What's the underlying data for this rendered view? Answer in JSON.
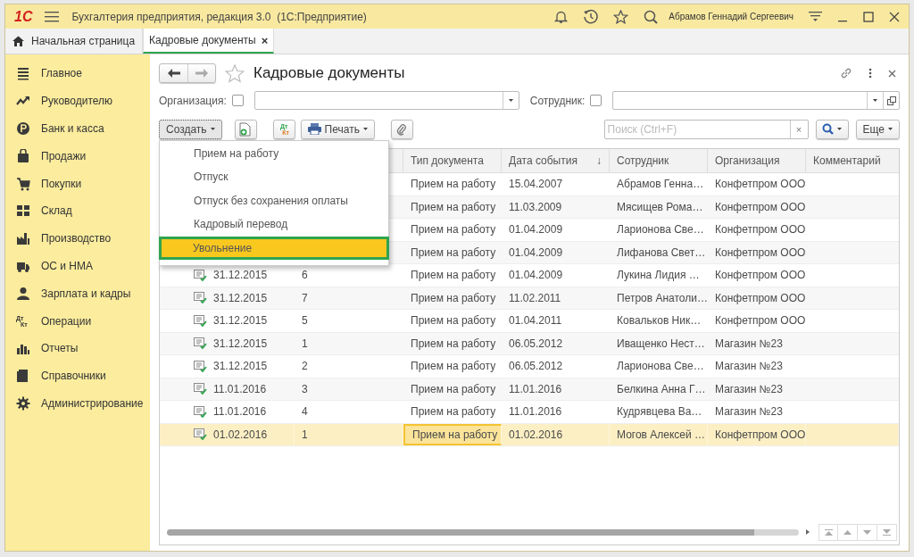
{
  "window": {
    "logo": "1С",
    "title": "Бухгалтерия предприятия, редакция 3.0  (1С:Предприятие)",
    "user": "Абрамов Геннадий Сергеевич"
  },
  "tabs": [
    {
      "label": "Начальная страница",
      "kind": "home",
      "selected": false
    },
    {
      "label": "Кадровые документы",
      "kind": "doc",
      "close": "×",
      "selected": true
    }
  ],
  "sidebar": {
    "items": [
      {
        "label": "Главное"
      },
      {
        "label": "Руководителю"
      },
      {
        "label": "Банк и касса"
      },
      {
        "label": "Продажи"
      },
      {
        "label": "Покупки"
      },
      {
        "label": "Склад"
      },
      {
        "label": "Производство"
      },
      {
        "label": "ОС и НМА"
      },
      {
        "label": "Зарплата и кадры"
      },
      {
        "label": "Операции",
        "glyph": [
          "Дт",
          "Кт"
        ]
      },
      {
        "label": "Отчеты"
      },
      {
        "label": "Справочники"
      },
      {
        "label": "Администрирование"
      }
    ]
  },
  "form": {
    "title": "Кадровые документы",
    "filters": [
      {
        "label": "Организация:",
        "checked": false,
        "open_button": false
      },
      {
        "label": "Сотрудник:",
        "checked": false,
        "open_button": true
      }
    ],
    "toolbar": {
      "create": "Создать",
      "dtkt": [
        "Дт",
        "Кт"
      ],
      "print": "Печать",
      "search_placeholder": "Поиск (Ctrl+F)",
      "search_clear": "×",
      "more": "Еще"
    },
    "create_menu": [
      {
        "label": "Прием на работу",
        "selected": false
      },
      {
        "label": "Отпуск",
        "selected": false
      },
      {
        "label": "Отпуск без сохранения оплаты",
        "selected": false
      },
      {
        "label": "Кадровый перевод",
        "selected": false
      },
      {
        "label": "Увольнение",
        "selected": true
      }
    ]
  },
  "table": {
    "columns": [
      {
        "label": "Тип документа"
      },
      {
        "label": "Дата события",
        "sort": "↓"
      },
      {
        "label": "Сотрудник"
      },
      {
        "label": "Организация"
      },
      {
        "label": "Комментарий"
      }
    ],
    "rows": [
      {
        "type": "Прием на работу",
        "event_date": "15.04.2007",
        "employee": "Абрамов Генна…",
        "organization": "Конфетпром ООО",
        "selected": false
      },
      {
        "type": "Прием на работу",
        "event_date": "11.03.2009",
        "employee": "Мясищев Рома…",
        "organization": "Конфетпром ООО",
        "selected": false
      },
      {
        "type": "Прием на работу",
        "event_date": "01.04.2009",
        "employee": "Ларионова Све…",
        "organization": "Конфетпром ООО",
        "selected": false
      },
      {
        "type": "Прием на работу",
        "event_date": "01.04.2009",
        "employee": "Лифанова Свет…",
        "organization": "Конфетпром ООО",
        "selected": false
      },
      {
        "date": "31.12.2015",
        "number": "6",
        "type": "Прием на работу",
        "event_date": "01.04.2009",
        "employee": "Лукина Лидия …",
        "organization": "Конфетпром ООО",
        "selected": false
      },
      {
        "date": "31.12.2015",
        "number": "7",
        "type": "Прием на работу",
        "event_date": "11.02.2011",
        "employee": "Петров Анатоли…",
        "organization": "Конфетпром ООО",
        "selected": false
      },
      {
        "date": "31.12.2015",
        "number": "5",
        "type": "Прием на работу",
        "event_date": "01.04.2011",
        "employee": "Ковальков Ник…",
        "organization": "Конфетпром ООО",
        "selected": false
      },
      {
        "date": "31.12.2015",
        "number": "1",
        "type": "Прием на работу",
        "event_date": "06.05.2012",
        "employee": "Иващенко Нест…",
        "organization": "Магазин №23",
        "selected": false
      },
      {
        "date": "31.12.2015",
        "number": "2",
        "type": "Прием на работу",
        "event_date": "06.05.2012",
        "employee": "Ларионова Све…",
        "organization": "Магазин №23",
        "selected": false
      },
      {
        "date": "11.01.2016",
        "number": "3",
        "type": "Прием на работу",
        "event_date": "11.01.2016",
        "employee": "Белкина Анна Г…",
        "organization": "Магазин №23",
        "selected": false
      },
      {
        "date": "11.01.2016",
        "number": "4",
        "type": "Прием на работу",
        "event_date": "11.01.2016",
        "employee": "Кудрявцева Ва…",
        "organization": "Магазин №23",
        "selected": false
      },
      {
        "date": "01.02.2016",
        "number": "1",
        "type": "Прием на работу",
        "event_date": "01.02.2016",
        "employee": "Могов Алексей …",
        "organization": "Конфетпром ООО",
        "selected": true
      }
    ]
  }
}
